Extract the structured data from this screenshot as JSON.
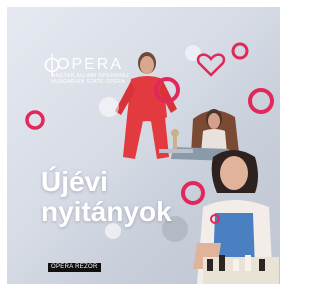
{
  "brand": {
    "wordmark": "OPERA",
    "line1": "MAGYAR ÁLLAMI OPERAHÁZ",
    "line2": "HUNGARIAN STATE OPERA"
  },
  "headline": {
    "line1": "Újévi",
    "line2": "nyitányok"
  },
  "sponsor": {
    "label": "OPERA REZOR"
  },
  "colors": {
    "accent": "#e0285a",
    "background": "#d6dbe5"
  },
  "icons": [
    "heart-icon",
    "ring-icon"
  ]
}
